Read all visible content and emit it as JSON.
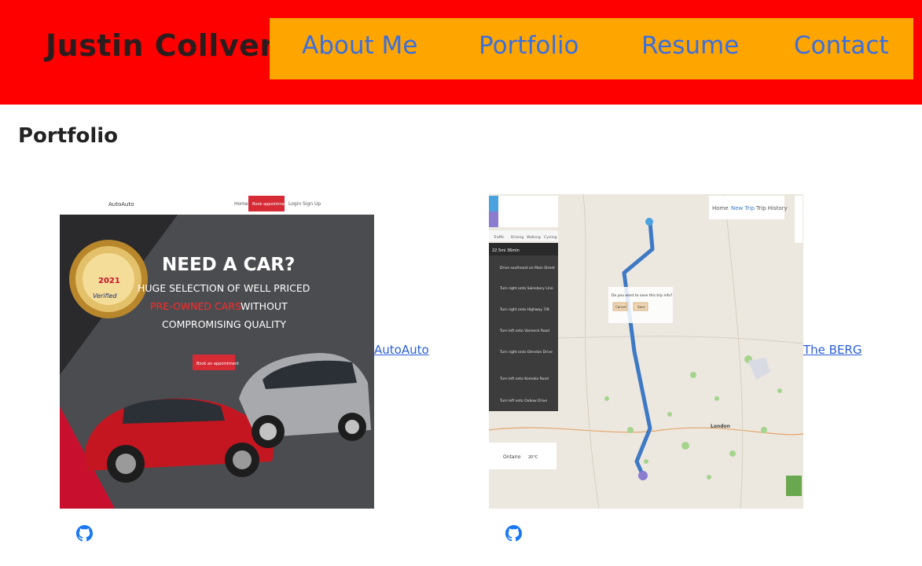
{
  "header": {
    "brand": "Justin Collver",
    "nav": [
      {
        "label": "About Me"
      },
      {
        "label": "Portfolio"
      },
      {
        "label": "Resume"
      },
      {
        "label": "Contact"
      }
    ]
  },
  "section": {
    "title": "Portfolio"
  },
  "projects": [
    {
      "name": "AutoAuto",
      "thumbnail": {
        "site_name": "AutoAuto",
        "nav": [
          "Home",
          "Book appointment",
          "Login",
          "Sign Up"
        ],
        "headline": "NEED A CAR?",
        "tagline_1": "HUGE SELECTION OF WELL PRICED",
        "tagline_2a": "PRE-OWNED CARS",
        "tagline_2b": " WITHOUT",
        "tagline_3": "COMPROMISING QUALITY",
        "cta": "Book an appointment",
        "badge_year": "2021",
        "badge_text": "Verified"
      }
    },
    {
      "name": "The BERG",
      "thumbnail": {
        "nav": [
          "Home",
          "New Trip",
          "Trip History"
        ],
        "modal_text": "Do you want to save this trip info?",
        "modal_buttons": [
          "Cancel",
          "Save"
        ],
        "modes": [
          "Traffic",
          "Driving",
          "Walking",
          "Cycling"
        ],
        "summary": "22.5mi 36min",
        "steps": [
          "Drive southeast on Main Street",
          "Turn right onto Sainsbury Line",
          "Turn right onto Highway 7/8",
          "Turn left onto Vanneck Road",
          "Turn right onto Glendon Drive",
          "Turn left onto Komoka Road",
          "Turn left onto Oxbow Drive"
        ],
        "weather_place": "Ontario",
        "weather_temp": "20°C",
        "city_label": "London"
      }
    }
  ],
  "colors": {
    "header_bg": "#ff0000",
    "nav_bg": "#ffa500",
    "nav_link": "#3a6fe0",
    "link": "#2a5fd8",
    "route": "#3d79c4"
  },
  "icons": {
    "repo": "github-icon"
  }
}
